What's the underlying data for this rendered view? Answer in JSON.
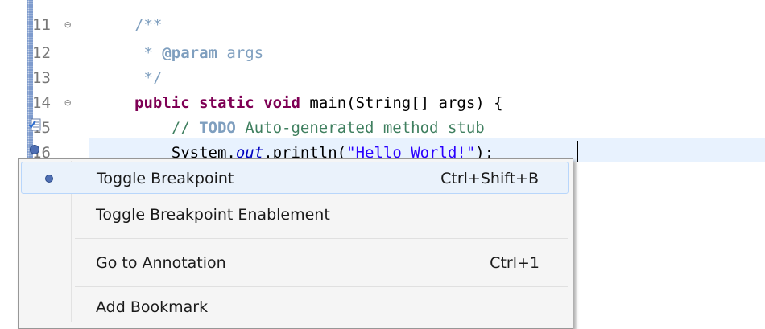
{
  "editor": {
    "lines": [
      {
        "number": "11",
        "fold": "⊖"
      },
      {
        "number": "12",
        "fold": ""
      },
      {
        "number": "13",
        "fold": ""
      },
      {
        "number": "14",
        "fold": "⊖"
      },
      {
        "number": "15",
        "fold": ""
      },
      {
        "number": "16",
        "fold": ""
      }
    ],
    "code": {
      "l11": "/**",
      "l12_star": " * ",
      "l12_tag": "@param",
      "l12_rest": " args",
      "l13": " */",
      "l14_mod1": "public",
      "l14_mod2": "static",
      "l14_mod3": "void",
      "l14_rest": " main(String[] args) {",
      "l15_slashes": "    // ",
      "l15_todo": "TODO",
      "l15_rest": " Auto-generated method stub",
      "l16_a": "    System.",
      "l16_out": "out",
      "l16_b": ".println(",
      "l16_str": "\"Hello World!\"",
      "l16_c": ");"
    }
  },
  "context_menu": {
    "items": [
      {
        "label": "Toggle Breakpoint",
        "shortcut": "Ctrl+Shift+B"
      },
      {
        "label": "Toggle Breakpoint Enablement",
        "shortcut": ""
      },
      {
        "label": "Go to Annotation",
        "shortcut": "Ctrl+1"
      },
      {
        "label": "Add Bookmark",
        "shortcut": ""
      }
    ]
  },
  "colors": {
    "keyword": "#7f0055",
    "string": "#2a00ff",
    "comment": "#3f7f5f",
    "javadoc": "#7f9fbf",
    "current_line": "#e8f2fe",
    "overview_bar": "#6f8fc7"
  },
  "icons": {
    "task_marker": "task-icon",
    "breakpoint": "breakpoint-icon",
    "fold": "fold-collapse-icon"
  }
}
